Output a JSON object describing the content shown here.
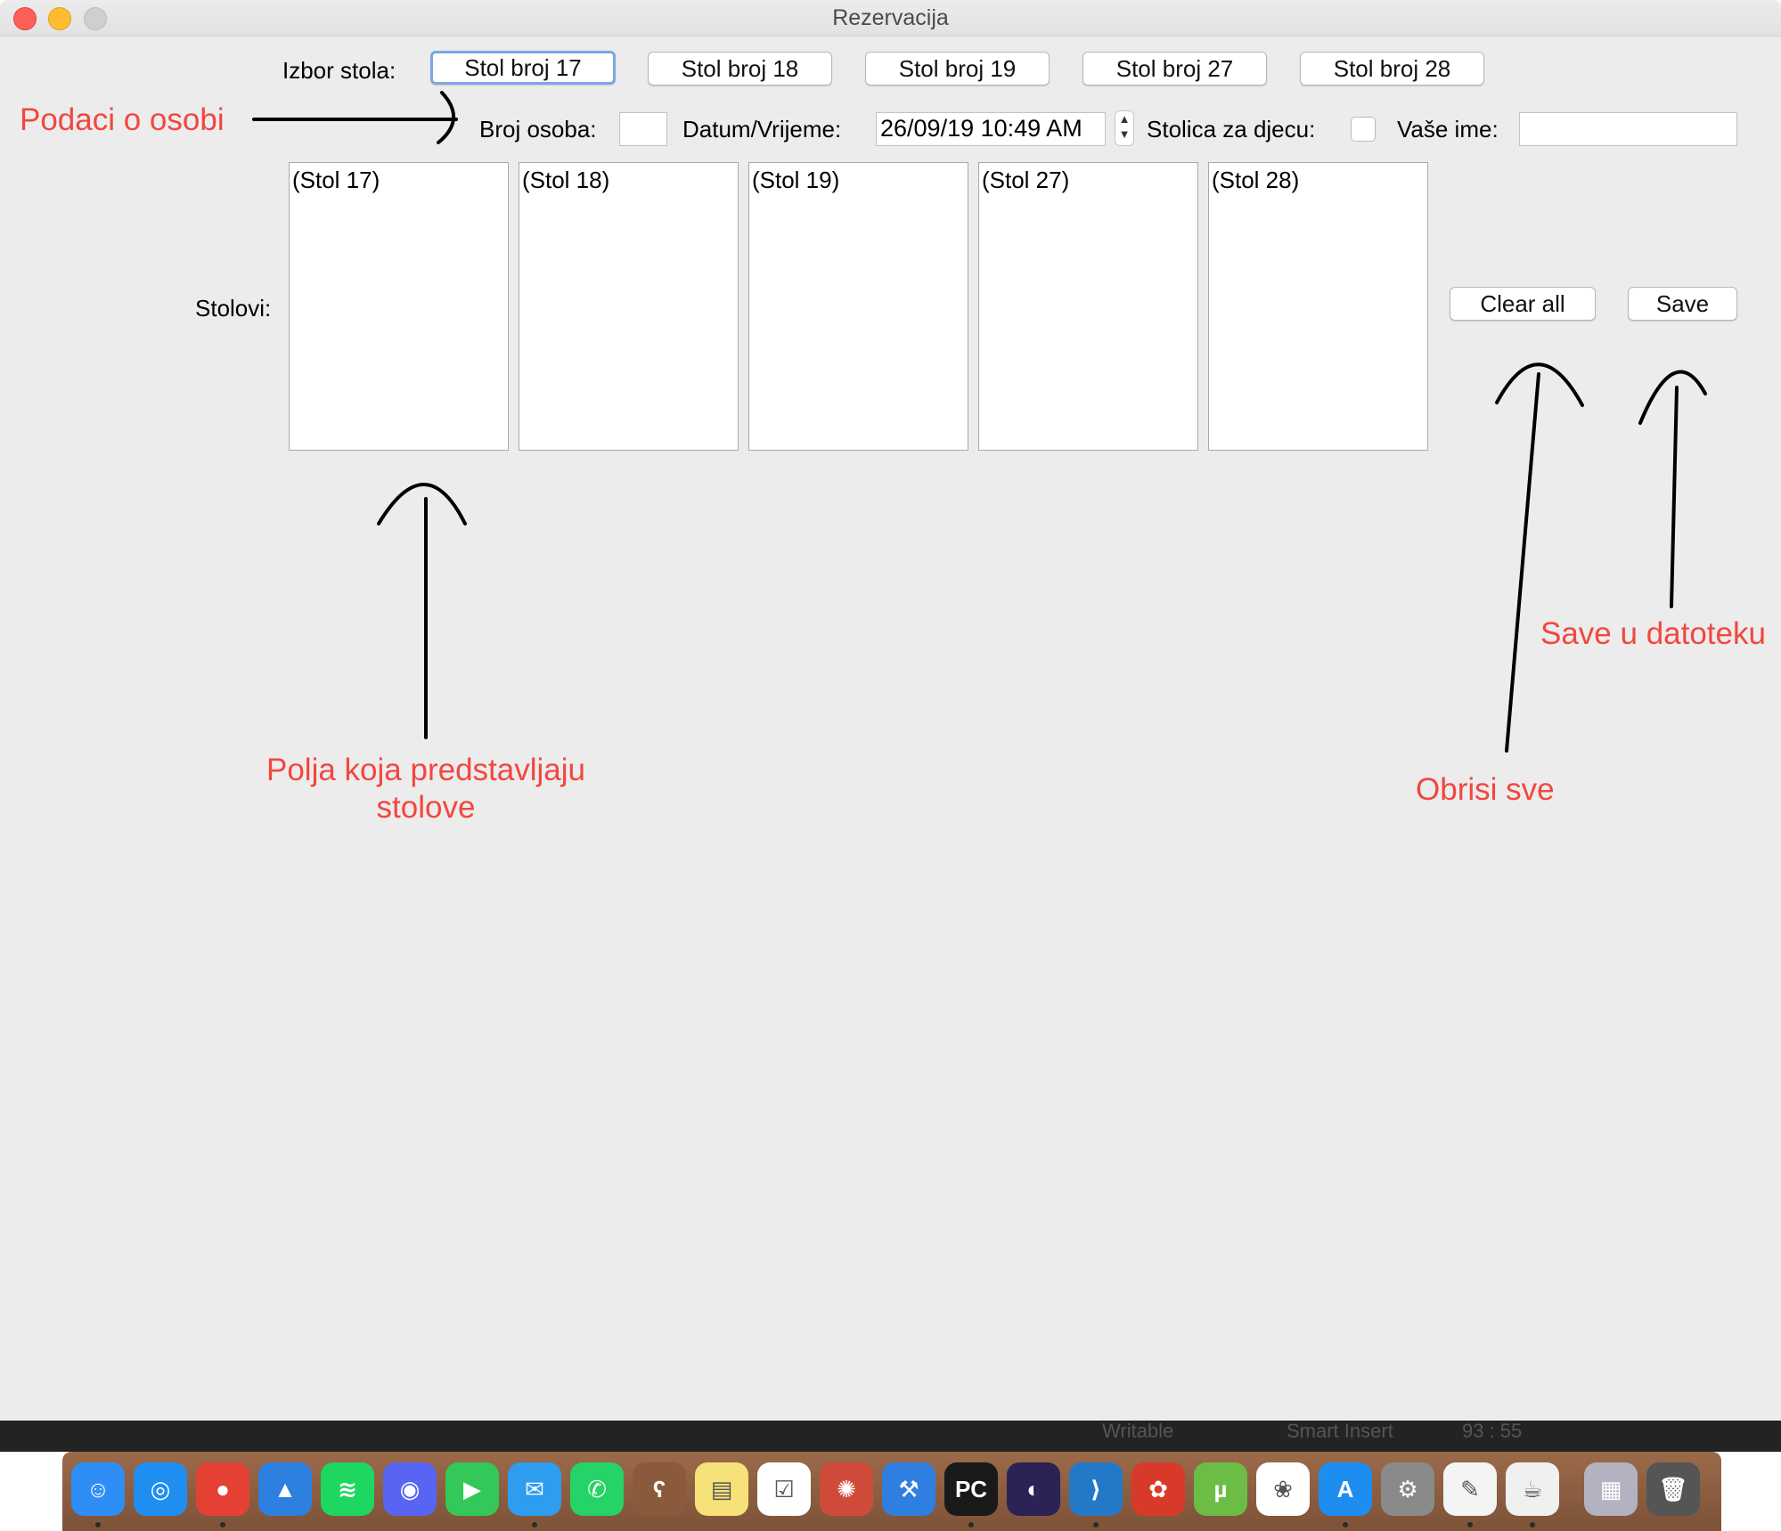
{
  "window": {
    "title": "Rezervacija"
  },
  "form": {
    "table_choice_label": "Izbor stola:",
    "table_buttons": [
      "Stol broj 17",
      "Stol broj 18",
      "Stol broj 19",
      "Stol broj 27",
      "Stol broj 28"
    ],
    "persons_label": "Broj osoba:",
    "persons_value": "",
    "datetime_label": "Datum/Vrijeme:",
    "datetime_value": "26/09/19 10:49 AM",
    "child_chair_label": "Stolica za djecu:",
    "name_label": "Vaše ime:",
    "name_value": "",
    "tables_label": "Stolovi:",
    "tables": [
      "(Stol 17)",
      "(Stol 18)",
      "(Stol 19)",
      "(Stol 27)",
      "(Stol 28)"
    ],
    "clear_button": "Clear all",
    "save_button": "Save"
  },
  "annotations": {
    "person_data": "Podaci o osobi",
    "table_fields_line1": "Polja koja predstavljaju",
    "table_fields_line2": "stolove",
    "clear_note": "Obrisi sve",
    "save_note": "Save u datoteku"
  },
  "statusbar": {
    "writable": "Writable",
    "insert": "Smart Insert",
    "position": "93 : 55"
  },
  "dock": {
    "icons": [
      "finder-icon",
      "safari-icon",
      "chrome-icon",
      "spark-icon",
      "spotify-icon",
      "discord-icon",
      "facetime-icon",
      "messages-icon",
      "whatsapp-icon",
      "bear-icon",
      "notes-icon",
      "reminders-icon",
      "aperture-icon",
      "xcode-icon",
      "pycharm-icon",
      "eclipse-icon",
      "vscode-icon",
      "popcorn-time-icon",
      "utorrent-icon",
      "photos-icon",
      "app-store-icon",
      "system-preferences-icon",
      "textedit-icon",
      "java-icon",
      "downloads-stack-icon",
      "trash-icon"
    ],
    "glyphs": [
      "☺",
      "◎",
      "●",
      "▲",
      "≋",
      "◉",
      "▶",
      "✉",
      "✆",
      "ʕ",
      "▤",
      "☑",
      "✺",
      "⚒",
      "PC",
      "◐",
      "⟩",
      "✿",
      "µ",
      "❀",
      "A",
      "⚙",
      "✎",
      "☕",
      "▦",
      "🗑"
    ],
    "colors": [
      "#2f8ef5",
      "#1e8ef0",
      "#e44134",
      "#2d7fe0",
      "#1ed760",
      "#5865f2",
      "#34c759",
      "#2e9df0",
      "#25d366",
      "#8b5a3c",
      "#f7e27a",
      "#ffffff",
      "#d04a3a",
      "#2f7fe0",
      "#1a1a1a",
      "#2c2255",
      "#2379c8",
      "#d83a2a",
      "#6cbd45",
      "#ffffff",
      "#1e8df0",
      "#8a8a8a",
      "#f4f4f4",
      "#f0f0f0",
      "#b2b2c0",
      "#555555"
    ]
  }
}
